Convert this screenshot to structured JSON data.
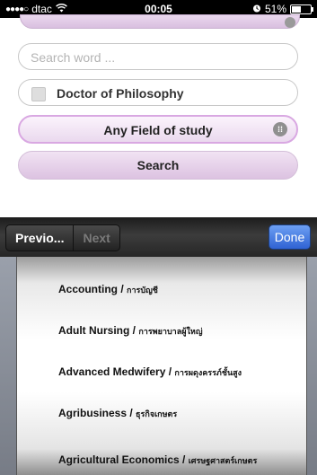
{
  "status_bar": {
    "carrier": "dtac",
    "time": "00:05",
    "battery": "51%",
    "battery_level": 0.51
  },
  "form": {
    "search_placeholder": "Search word ...",
    "degree_label": "Doctor of Philosophy",
    "degree_checked": false,
    "field_label": "Any Field of study",
    "search_button": "Search"
  },
  "toolbar": {
    "previous_label": "Previo...",
    "next_label": "Next",
    "done_label": "Done"
  },
  "picker": {
    "items": [
      {
        "en": "Accounting",
        "th": "การบัญชี"
      },
      {
        "en": "Adult Nursing",
        "th": "การพยาบาลผู้ใหญ่"
      },
      {
        "en": "Advanced Medwifery",
        "th": "การผดุงครรภ์ชั้นสูง"
      },
      {
        "en": "Agribusiness",
        "th": "ธุรกิจเกษตร"
      },
      {
        "en": "Agricultural Economics",
        "th": "เศรษฐศาสตร์เกษตร"
      }
    ]
  }
}
